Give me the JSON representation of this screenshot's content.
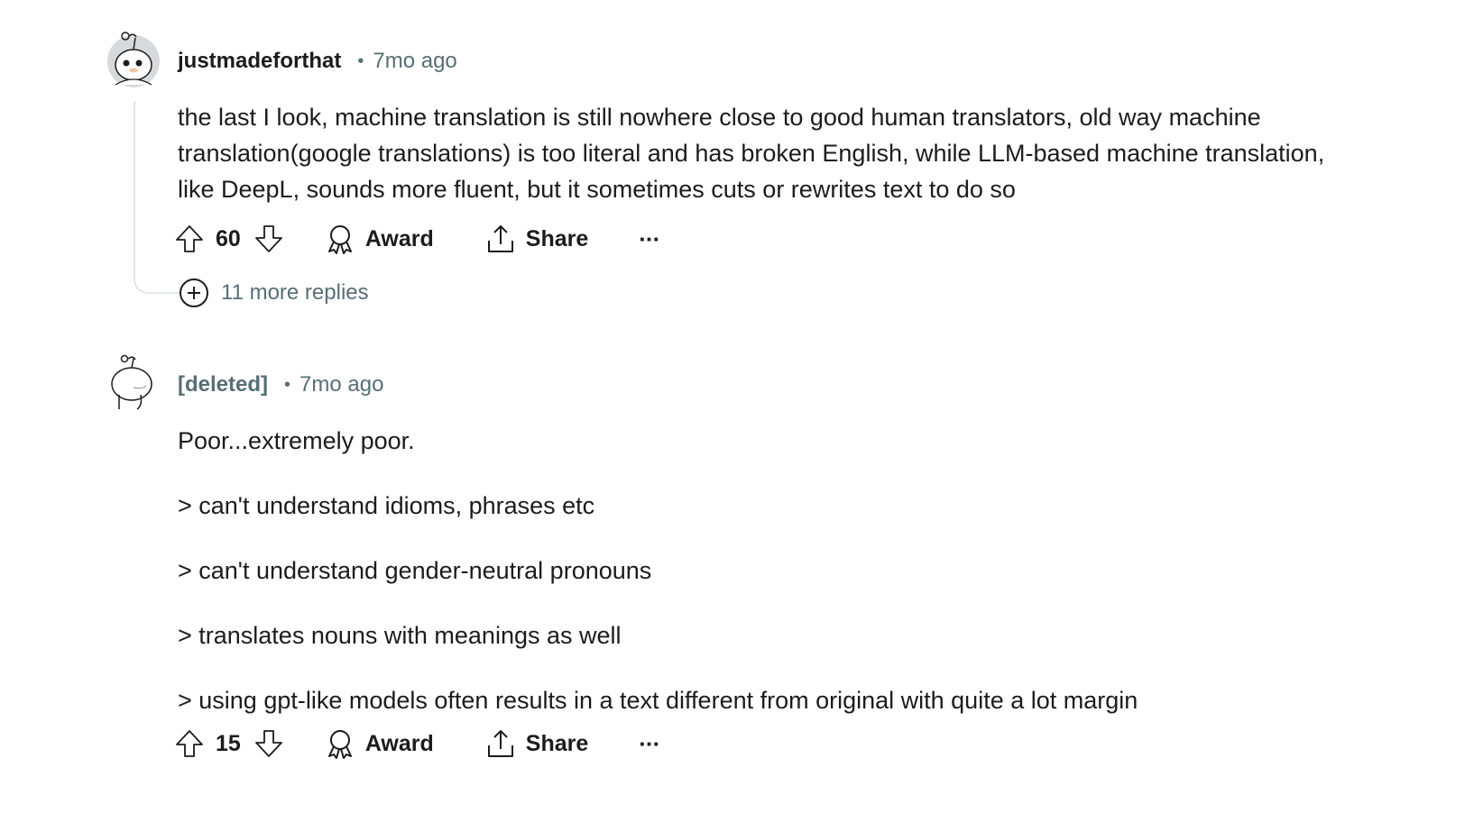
{
  "comments": [
    {
      "username": "justmadeforthat",
      "separator": "•",
      "time": "7mo ago",
      "avatar_icon": "snoo-avatar-icon",
      "body": [
        "the last I look, machine translation is still nowhere close to good human translators, old way machine",
        "translation(google translations) is too literal and has broken English, while LLM-based machine translation,",
        "like DeepL, sounds more fluent, but it sometimes cuts or rewrites text to do so"
      ],
      "score": "60",
      "award_label": "Award",
      "share_label": "Share",
      "more_label": "···",
      "more_replies": "11 more replies"
    },
    {
      "username": "[deleted]",
      "separator": "•",
      "time": "7mo ago",
      "avatar_icon": "deleted-snoo-avatar-icon",
      "body": [
        "Poor...extremely poor.",
        "> can't understand idioms, phrases etc",
        "> can't understand gender-neutral pronouns",
        "> translates nouns with meanings as well",
        "> using gpt-like models often results in a text different from original with quite a lot margin"
      ],
      "score": "15",
      "award_label": "Award",
      "share_label": "Share",
      "more_label": "···"
    }
  ],
  "colors": {
    "text": "#1c1c1c",
    "meta": "#576f76",
    "thread_line": "#e2e7e9"
  }
}
